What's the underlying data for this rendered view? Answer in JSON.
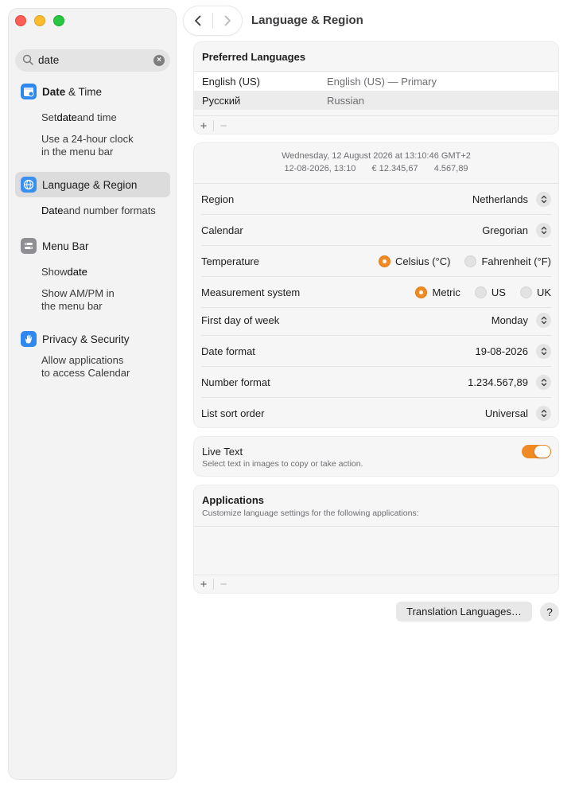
{
  "window": {
    "title": "Language & Region"
  },
  "search": {
    "value": "date"
  },
  "sidebar": {
    "items": [
      {
        "label_bold": "Date",
        "label_rest": " & Time",
        "subs": [
          {
            "pre": "Set ",
            "bold": "date",
            "post": " and time"
          },
          {
            "pre": "Use a 24-hour clock in the menu bar",
            "bold": "",
            "post": ""
          }
        ]
      },
      {
        "label": "Language & Region",
        "subs": [
          {
            "pre": "",
            "bold": "Date",
            "post": " and number formats"
          }
        ]
      },
      {
        "label": "Menu Bar",
        "subs": [
          {
            "pre": "Show ",
            "bold": "date",
            "post": ""
          },
          {
            "pre": "Show AM/PM in the menu bar",
            "bold": "",
            "post": ""
          }
        ]
      },
      {
        "label": "Privacy & Security",
        "subs": [
          {
            "pre": "Allow applications to access Calendar",
            "bold": "",
            "post": ""
          }
        ]
      }
    ]
  },
  "preferred": {
    "heading": "Preferred Languages",
    "languages": [
      {
        "name": "English (US)",
        "desc": "English (US) — Primary"
      },
      {
        "name": "Русский",
        "desc": "Russian"
      }
    ],
    "add": "+",
    "remove": "−"
  },
  "preview": {
    "line1": "Wednesday, 12 August 2026 at 13:10:46 GMT+2",
    "line2_date": "12-08-2026, 13:10",
    "line2_currency": "€ 12.345,67",
    "line2_number": "4.567,89"
  },
  "settings": {
    "region": {
      "label": "Region",
      "value": "Netherlands"
    },
    "calendar": {
      "label": "Calendar",
      "value": "Gregorian"
    },
    "temperature": {
      "label": "Temperature",
      "options": [
        "Celsius (°C)",
        "Fahrenheit (°F)"
      ],
      "selected": "Celsius (°C)"
    },
    "measurement": {
      "label": "Measurement system",
      "options": [
        "Metric",
        "US",
        "UK"
      ],
      "selected": "Metric"
    },
    "first_day": {
      "label": "First day of week",
      "value": "Monday"
    },
    "date_format": {
      "label": "Date format",
      "value": "19-08-2026"
    },
    "number_format": {
      "label": "Number format",
      "value": "1.234.567,89"
    },
    "sort_order": {
      "label": "List sort order",
      "value": "Universal"
    }
  },
  "live_text": {
    "title": "Live Text",
    "desc": "Select text in images to copy or take action.",
    "enabled": true
  },
  "applications": {
    "heading": "Applications",
    "desc": "Customize language settings for the following applications:",
    "add": "+",
    "remove": "−"
  },
  "buttons": {
    "translation": "Translation Languages…",
    "help": "?"
  },
  "colors": {
    "accent": "#f08a24",
    "sidebar_bg": "#f3f3f3",
    "card_bg": "#f6f6f6"
  }
}
